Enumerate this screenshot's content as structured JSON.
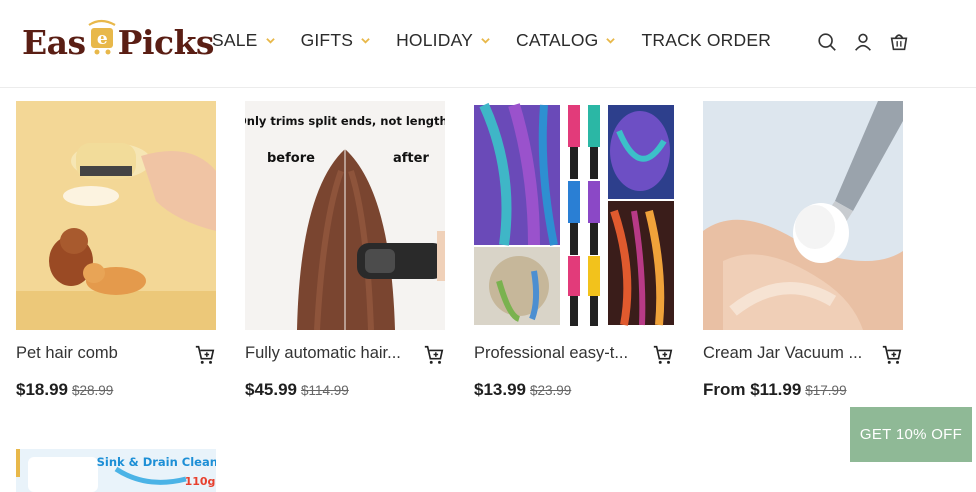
{
  "brand": {
    "logo_left": "Eas",
    "logo_mid": "e",
    "logo_right": "Picks"
  },
  "nav": {
    "items": [
      {
        "label": "SALE",
        "has_dropdown": true
      },
      {
        "label": "GIFTS",
        "has_dropdown": true
      },
      {
        "label": "HOLIDAY",
        "has_dropdown": true
      },
      {
        "label": "CATALOG",
        "has_dropdown": true
      },
      {
        "label": "TRACK ORDER",
        "has_dropdown": false
      }
    ],
    "chevron_color": "#e8b84a"
  },
  "header_icons": [
    "search-icon",
    "account-icon",
    "cart-icon"
  ],
  "products": [
    {
      "title": "Pet hair comb",
      "price": "$18.99",
      "old_price": "$28.99"
    },
    {
      "title": "Fully automatic hair...",
      "price": "$45.99",
      "old_price": "$114.99",
      "image_caption": "Only trims split ends, not length!",
      "before_label": "before",
      "after_label": "after"
    },
    {
      "title": "Professional easy-t...",
      "price": "$13.99",
      "old_price": "$23.99"
    },
    {
      "title": "Cream Jar Vacuum ...",
      "price": "From $11.99",
      "old_price": "$17.99"
    },
    {
      "image_caption": "Sink & Drain Cleaner",
      "image_badge": "110g"
    }
  ],
  "promo": {
    "label": "GET 10% OFF",
    "color": "#8fb996"
  },
  "colors": {
    "brand": "#5a1e14",
    "accent": "#e8b84a"
  }
}
